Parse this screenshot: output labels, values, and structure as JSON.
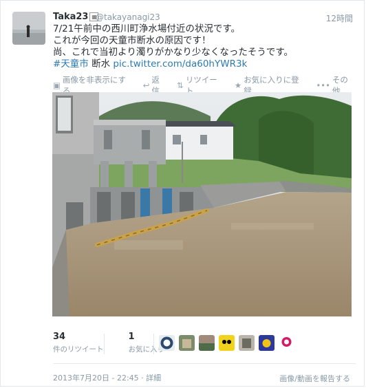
{
  "tweet": {
    "name": "Taka23",
    "handle": "@takayanagi23",
    "time": "12時間",
    "text": {
      "line1": "7/21午前中の西川町浄水場付近の状況です。",
      "line2": "これが今回の天童市断水の原因です！",
      "line3": "尚、これで当初より濁りがかなり少なくなったそうです。",
      "hashtag": "#天童市",
      "word": "断水",
      "link": "pic.twitter.com/da60hYWR3k"
    },
    "actions": {
      "hide_image": "画像を非表示にする",
      "reply": "返信",
      "retweet": "リツイート",
      "favorite": "お気に入りに登録",
      "more": "その他"
    },
    "stats": {
      "retweets_count": "34",
      "retweets_label": "件のリツイート",
      "favorites_count": "1",
      "favorites_label": "お気に入り"
    },
    "footer": {
      "timestamp": "2013年7月20日 - 22:45",
      "details": "詳細",
      "report": "画像/動画を報告する"
    }
  },
  "icons": {
    "reply": "reply-icon",
    "retweet": "retweet-icon",
    "favorite": "star-icon",
    "more": "ellipsis-icon",
    "hide": "image-icon"
  },
  "colors": {
    "link": "#2a7ab0",
    "muted": "#8899a6",
    "text": "#292f33"
  }
}
